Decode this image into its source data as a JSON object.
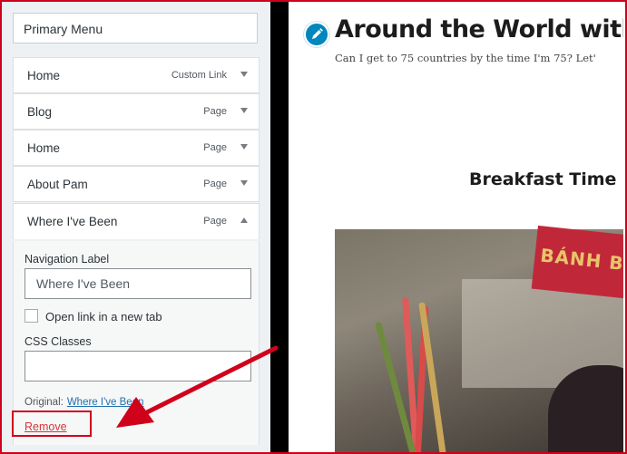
{
  "panel": {
    "menu_name": "Primary Menu",
    "items": [
      {
        "label": "Home",
        "type": "Custom Link"
      },
      {
        "label": "Blog",
        "type": "Page"
      },
      {
        "label": "Home",
        "type": "Page"
      },
      {
        "label": "About Pam",
        "type": "Page"
      },
      {
        "label": "Where I've Been",
        "type": "Page"
      }
    ],
    "settings": {
      "nav_label_title": "Navigation Label",
      "nav_label_value": "Where I've Been",
      "new_tab_label": "Open link in a new tab",
      "css_classes_title": "CSS Classes",
      "css_classes_value": "",
      "original_label": "Original:",
      "original_link": "Where I've Been",
      "remove_label": "Remove"
    }
  },
  "preview": {
    "site_title": "Around the World with",
    "tagline": "Can I get to 75 countries by the time I'm 75? Let'",
    "post_title": "Breakfast Time",
    "photo_sign_text": "BÁNH BA"
  },
  "annotation_color": "#d0021b"
}
